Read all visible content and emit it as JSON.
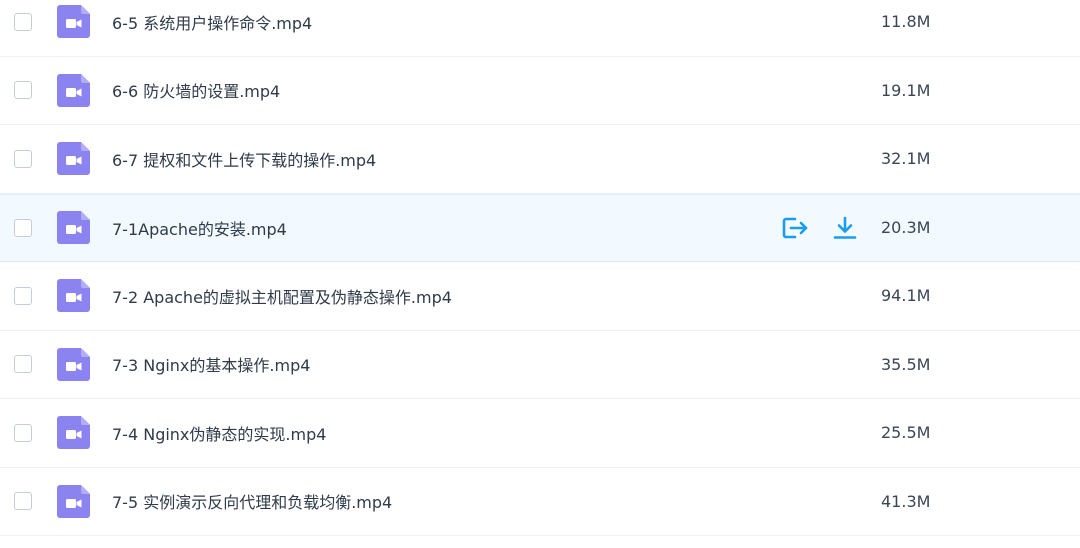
{
  "colors": {
    "icon_purple": "#8b83f0",
    "action_blue": "#1a9cf0",
    "highlight_bg": "#f2f9ff"
  },
  "files": [
    {
      "name": "6-5 系统用户操作命令.mp4",
      "size": "11.8M",
      "icon": "video-file-icon"
    },
    {
      "name": "6-6 防火墙的设置.mp4",
      "size": "19.1M",
      "icon": "video-file-icon"
    },
    {
      "name": "6-7 提权和文件上传下载的操作.mp4",
      "size": "32.1M",
      "icon": "video-file-icon"
    },
    {
      "name": "7-1Apache的安装.mp4",
      "size": "20.3M",
      "icon": "video-file-icon",
      "hovered": true
    },
    {
      "name": "7-2 Apache的虚拟主机配置及伪静态操作.mp4",
      "size": "94.1M",
      "icon": "video-file-icon"
    },
    {
      "name": "7-3 Nginx的基本操作.mp4",
      "size": "35.5M",
      "icon": "video-file-icon"
    },
    {
      "name": "7-4 Nginx伪静态的实现.mp4",
      "size": "25.5M",
      "icon": "video-file-icon"
    },
    {
      "name": "7-5 实例演示反向代理和负载均衡.mp4",
      "size": "41.3M",
      "icon": "video-file-icon"
    }
  ],
  "row_actions": [
    "share-icon",
    "download-icon"
  ]
}
